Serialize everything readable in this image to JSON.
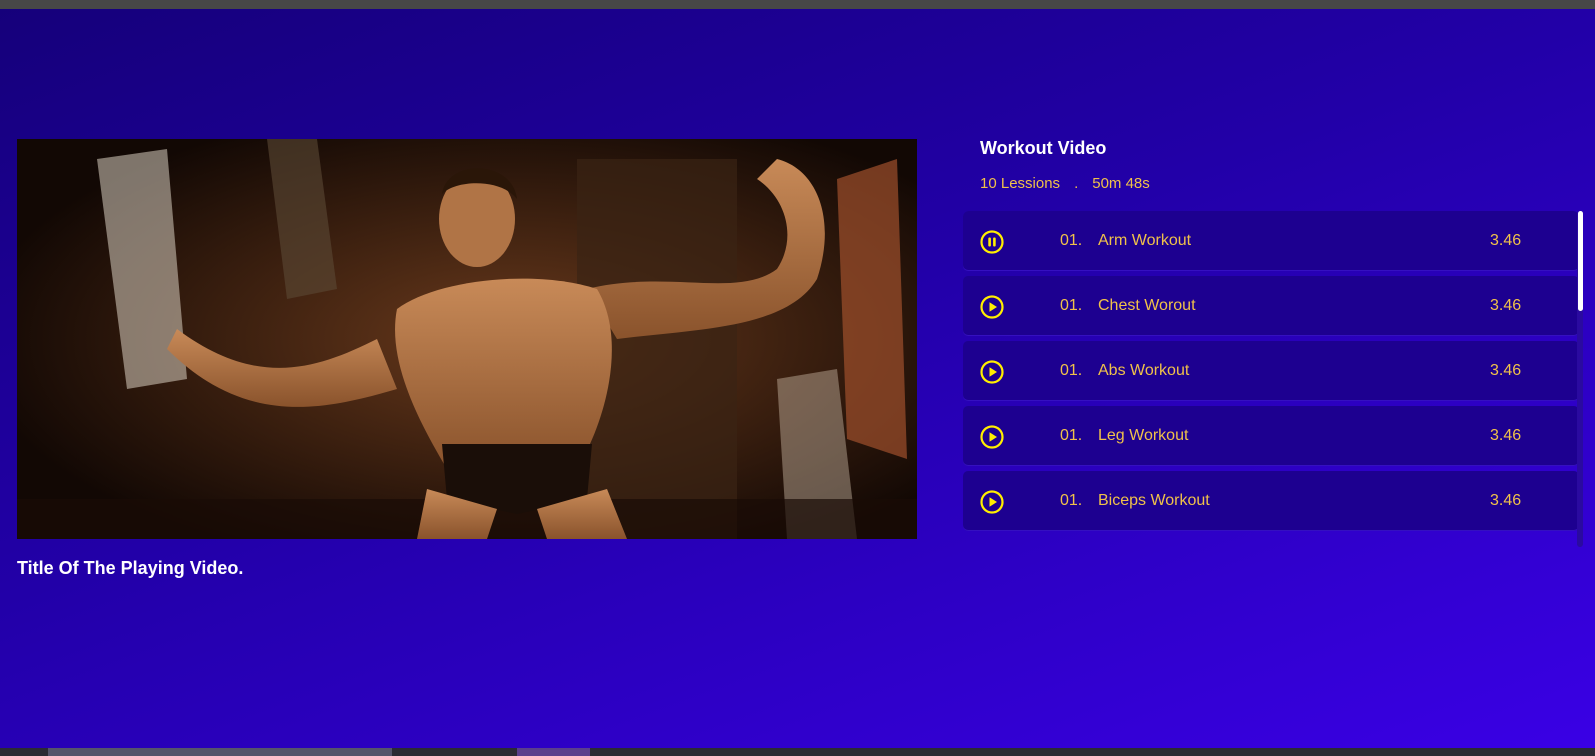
{
  "player": {
    "image": "bodybuilder-posing-video-frame",
    "title": "Title Of The Playing Video."
  },
  "playlist": {
    "title": "Workout Video",
    "lessons_count": "10 Lessions",
    "separator": ".",
    "total_duration": "50m 48s",
    "lessons": [
      {
        "number": "01.",
        "name": "Arm Workout",
        "duration": "3.46",
        "icon": "pause-circle-icon",
        "state": "playing"
      },
      {
        "number": "01.",
        "name": "Chest Worout",
        "duration": "3.46",
        "icon": "play-circle-icon",
        "state": "idle"
      },
      {
        "number": "01.",
        "name": "Abs Workout",
        "duration": "3.46",
        "icon": "play-circle-icon",
        "state": "idle"
      },
      {
        "number": "01.",
        "name": "Leg Workout",
        "duration": "3.46",
        "icon": "play-circle-icon",
        "state": "idle"
      },
      {
        "number": "01.",
        "name": "Biceps Workout",
        "duration": "3.46",
        "icon": "play-circle-icon",
        "state": "idle"
      }
    ]
  },
  "colors": {
    "accent": "#f0c14a",
    "icon": "#ffee00",
    "row_bg": "#1d0090",
    "text_primary": "#ffffff"
  }
}
